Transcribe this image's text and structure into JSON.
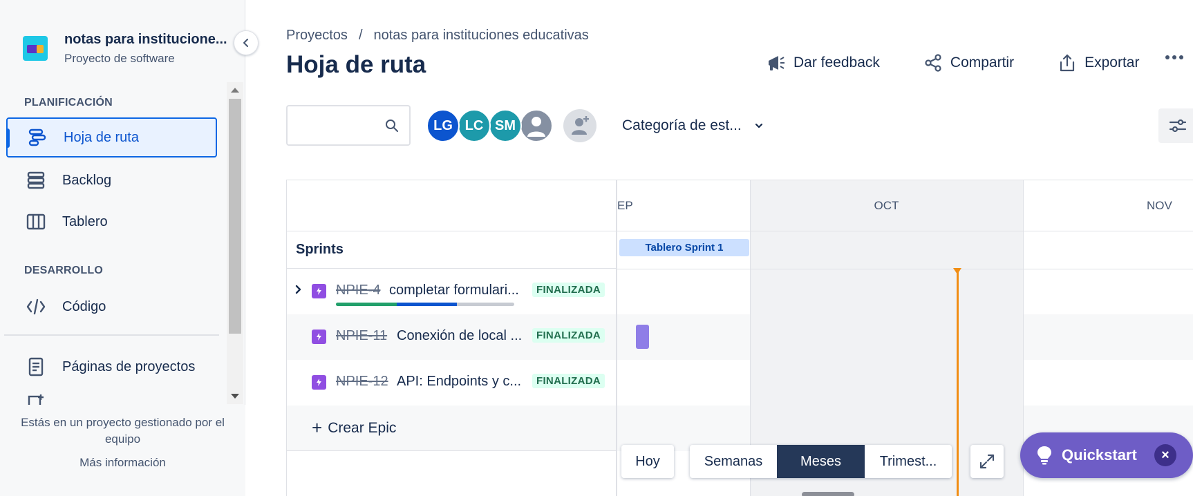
{
  "sidebar": {
    "project_name": "notas para institucione...",
    "project_type": "Proyecto de software",
    "sections": [
      {
        "label": "PLANIFICACIÓN"
      },
      {
        "label": "DESARROLLO"
      }
    ],
    "items": [
      {
        "label": "Hoja de ruta",
        "icon": "roadmap-icon",
        "active": true
      },
      {
        "label": "Backlog",
        "icon": "backlog-icon"
      },
      {
        "label": "Tablero",
        "icon": "board-icon"
      },
      {
        "label": "Código",
        "icon": "code-icon"
      },
      {
        "label": "Páginas de proyectos",
        "icon": "page-icon"
      }
    ],
    "footer_text": "Estás en un proyecto gestionado por el equipo",
    "footer_link": "Más información"
  },
  "header": {
    "breadcrumb": [
      "Proyectos",
      "/",
      "notas para instituciones educativas"
    ],
    "title": "Hoja de ruta",
    "actions": {
      "feedback": "Dar feedback",
      "share": "Compartir",
      "export": "Exportar"
    }
  },
  "toolbar": {
    "search_placeholder": "",
    "avatars": [
      {
        "initials": "LG",
        "color": "#0c55cf"
      },
      {
        "initials": "LC",
        "color": "#1d9aaa"
      },
      {
        "initials": "SM",
        "color": "#1d9aaa"
      },
      {
        "initials": "",
        "color": "#8590a2"
      }
    ],
    "status_filter": "Categoría de est..."
  },
  "timeline": {
    "months": [
      "EP",
      "OCT",
      "NOV"
    ],
    "sprints_label": "Sprints",
    "sprint_chip": "Tablero Sprint 1",
    "epics": [
      {
        "key": "NPIE-4",
        "title": "completar formulari...",
        "status": "FINALIZADA",
        "expandable": true,
        "progress_done": 0.34,
        "progress_in_progress": 0.34
      },
      {
        "key": "NPIE-11",
        "title": "Conexión de local ...",
        "status": "FINALIZADA",
        "expandable": false
      },
      {
        "key": "NPIE-12",
        "title": "API: Endpoints y c...",
        "status": "FINALIZADA",
        "expandable": false
      }
    ],
    "create_epic": "Crear Epic"
  },
  "controls": {
    "today": "Hoy",
    "scales": [
      {
        "label": "Semanas",
        "active": false
      },
      {
        "label": "Meses",
        "active": true
      },
      {
        "label": "Trimest...",
        "active": false
      }
    ]
  },
  "quickstart": {
    "label": "Quickstart",
    "close": "×"
  },
  "colors": {
    "accent": "#0c66e4",
    "epic": "#904ee2",
    "today": "#f18d13",
    "quickstart": "#6e5dc6"
  }
}
